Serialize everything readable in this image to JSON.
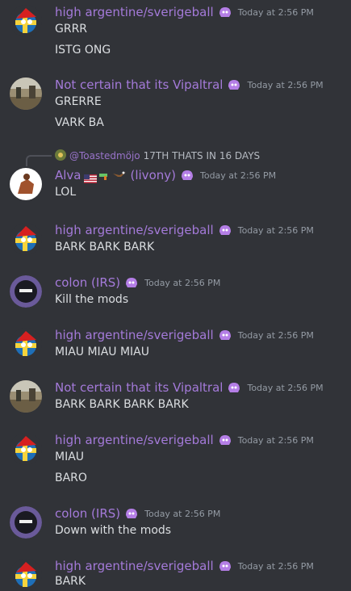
{
  "messages": [
    {
      "user": "high argentine/sverigeball",
      "time": "Today at 2:56 PM",
      "lines": [
        "GRRR",
        "ISTG ONG"
      ],
      "avatar": "countryball"
    },
    {
      "user": "Not certain that its Vipaltral",
      "time": "Today at 2:56 PM",
      "lines": [
        "GRERRE",
        "VARK BA"
      ],
      "avatar": "landscape"
    },
    {
      "user": "Alva",
      "tag": "(livony)",
      "time": "Today at 2:56 PM",
      "lines": [
        "LOL"
      ],
      "avatar": "figure",
      "reply": {
        "user": "@Toastedmöjo",
        "text": "17TH THATS IN 16 DAYS"
      }
    },
    {
      "user": "high argentine/sverigeball",
      "time": "Today at 2:56 PM",
      "lines": [
        "BARK BARK BARK"
      ],
      "avatar": "countryball"
    },
    {
      "user": "colon (IRS)",
      "time": "Today at 2:56 PM",
      "lines": [
        "Kill the mods"
      ],
      "avatar": "dark"
    },
    {
      "user": "high argentine/sverigeball",
      "time": "Today at 2:56 PM",
      "lines": [
        "MIAU MIAU MIAU"
      ],
      "avatar": "countryball"
    },
    {
      "user": "Not certain that its Vipaltral",
      "time": "Today at 2:56 PM",
      "lines": [
        "BARK BARK BARK BARK"
      ],
      "avatar": "landscape"
    },
    {
      "user": "high argentine/sverigeball",
      "time": "Today at 2:56 PM",
      "lines": [
        "MIAU",
        "BARO"
      ],
      "avatar": "countryball"
    },
    {
      "user": "colon (IRS)",
      "time": "Today at 2:56 PM",
      "lines": [
        "Down with the mods"
      ],
      "avatar": "dark"
    },
    {
      "user": "high argentine/sverigeball",
      "time": "Today at 2:56 PM",
      "lines": [
        "BARK"
      ],
      "avatar": "countryball"
    }
  ],
  "colors": {
    "background": "#313338",
    "username": "#a47ad9",
    "timestamp": "#949ba4",
    "text": "#dbdee1"
  }
}
